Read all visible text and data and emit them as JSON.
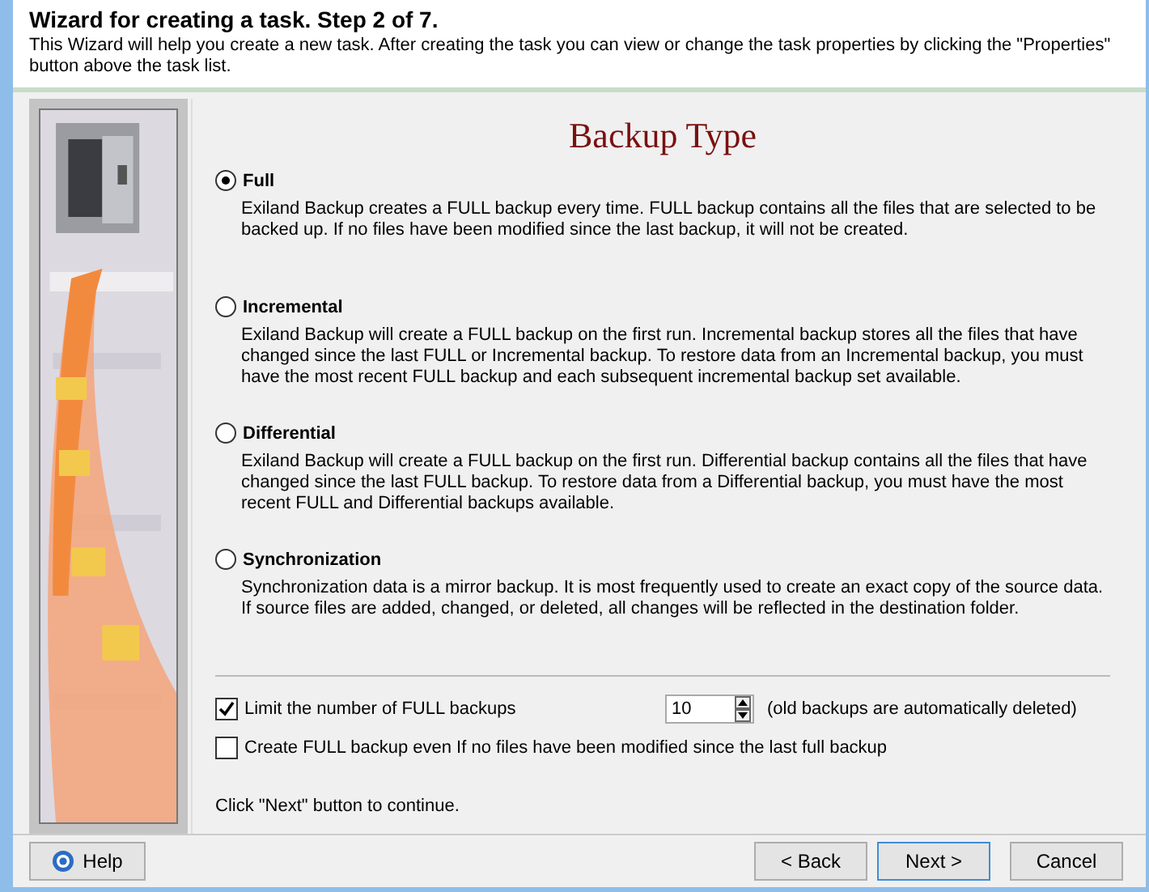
{
  "header": {
    "title": "Wizard for creating a task. Step 2 of 7.",
    "description": "This Wizard will help you create a new task. After creating the task you can view or change the task properties by clicking the \"Properties\" button above the task list."
  },
  "page_title": "Backup Type",
  "backup_types": [
    {
      "label": "Full",
      "selected": true,
      "description": "Exiland Backup creates a FULL backup every time. FULL backup contains all the files that are selected to be backed up. If no files have been modified since the last backup, it will not be created."
    },
    {
      "label": "Incremental",
      "selected": false,
      "description": "Exiland Backup will create a FULL backup on the first run. Incremental backup stores all the files that have changed since the last FULL or Incremental backup. To restore data from an Incremental backup, you must have the most recent FULL backup and each subsequent incremental backup set available."
    },
    {
      "label": "Differential",
      "selected": false,
      "description": "Exiland Backup will create a FULL backup on the first run. Differential backup contains all the files that have changed since the last FULL backup. To restore data from a Differential backup, you must have the most recent FULL and Differential backups available."
    },
    {
      "label": "Synchronization",
      "selected": false,
      "description": "Synchronization data is a mirror backup. It is most frequently used to create an exact copy of the source data. If source files are added, changed, or deleted, all changes will be reflected in the destination folder."
    }
  ],
  "options": [
    {
      "kind": "limit",
      "label": "Limit the number of FULL backups",
      "checked": true,
      "value": "10",
      "note": "(old backups are automatically deleted)"
    },
    {
      "kind": "plain",
      "label": "Create FULL backup even If no files have been modified since the last full backup",
      "checked": false
    }
  ],
  "hint": "Click \"Next\" button to continue.",
  "buttons": {
    "help": "Help",
    "back": "< Back",
    "next": "Next >",
    "cancel": "Cancel"
  }
}
